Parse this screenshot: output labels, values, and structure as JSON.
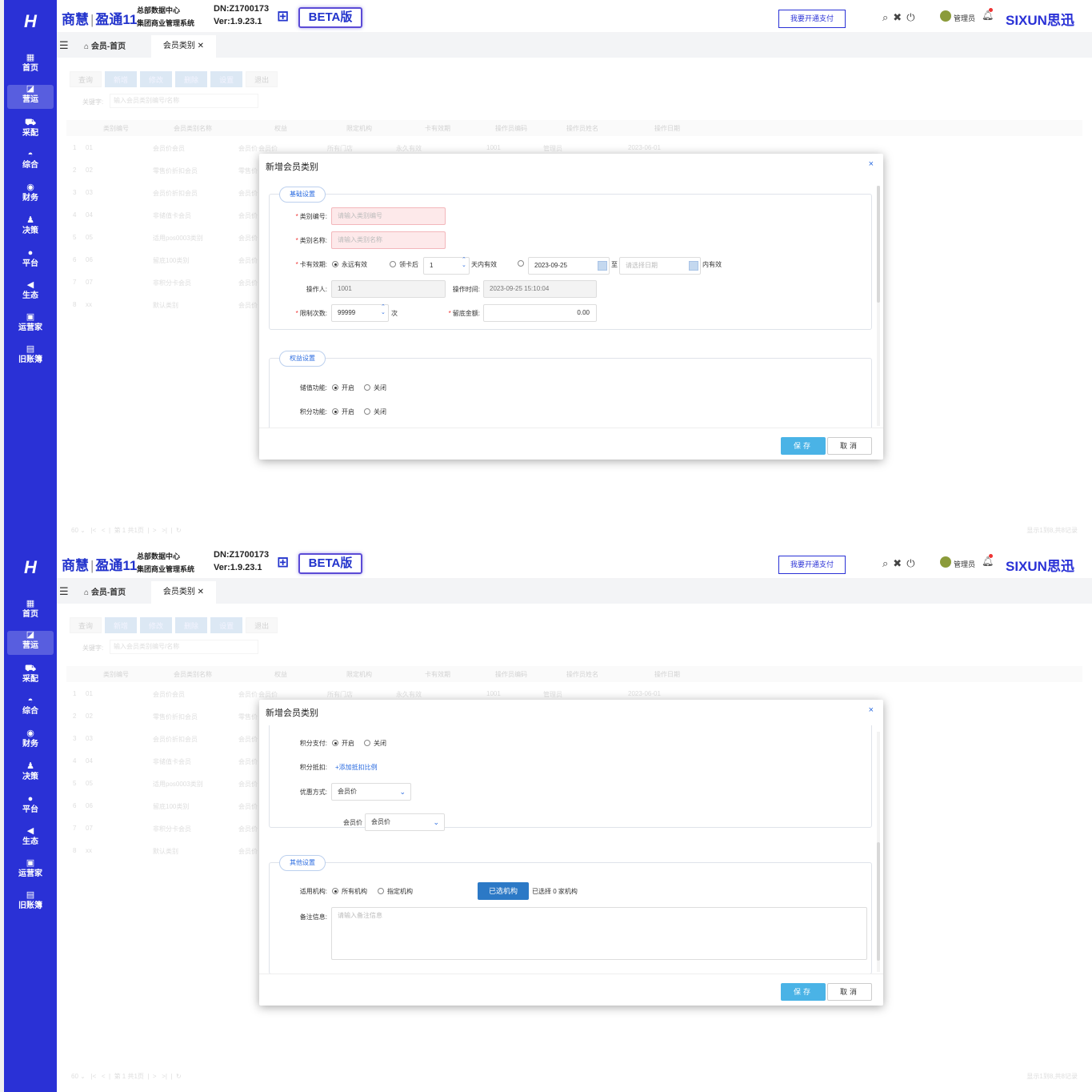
{
  "app": {
    "logo": "H",
    "brand_left": "商慧",
    "brand_right": "盈通11",
    "sys_line1": "总部数据中心",
    "sys_line2": "集团商业管理系统",
    "dn": "DN:Z1700173",
    "ver": "Ver:1.9.23.1",
    "beta": "BETA版",
    "pay_button": "我要开通支付",
    "user": "管理员",
    "vendor": "SIXUN思迅"
  },
  "sidebar": {
    "items": [
      {
        "label": "首页",
        "icon": "home-icon",
        "glyph": "▦"
      },
      {
        "label": "营运",
        "icon": "chart-icon",
        "glyph": "◪"
      },
      {
        "label": "采配",
        "icon": "truck-icon",
        "glyph": "⛟"
      },
      {
        "label": "综合",
        "icon": "bag-icon",
        "glyph": "◓"
      },
      {
        "label": "财务",
        "icon": "finance-icon",
        "glyph": "◉"
      },
      {
        "label": "决策",
        "icon": "decision-icon",
        "glyph": "♟"
      },
      {
        "label": "平台",
        "icon": "platform-icon",
        "glyph": "●"
      },
      {
        "label": "生态",
        "icon": "ecology-icon",
        "glyph": "◀"
      },
      {
        "label": "运营家",
        "icon": "operator-icon",
        "glyph": "▣"
      },
      {
        "label": "旧账簿",
        "icon": "ledger-icon",
        "glyph": "▤"
      }
    ]
  },
  "tabs": {
    "home": "会员-首页",
    "active": "会员类别"
  },
  "toolbar": {
    "query": "查询",
    "add": "新增",
    "edit": "修改",
    "delete": "删除",
    "settings": "设置",
    "exit": "退出"
  },
  "search": {
    "label": "关键字:",
    "placeholder": "输入会员类别编号/名称"
  },
  "table": {
    "headers": [
      "类别编号",
      "会员类别名称",
      "权益",
      "限定机构",
      "卡有效期",
      "操作员编码",
      "操作员姓名",
      "操作日期"
    ],
    "rows": [
      {
        "idx": "1",
        "code": "01",
        "name": "会员价会员",
        "benefit": "会员价"
      },
      {
        "idx": "2",
        "code": "02",
        "name": "零售价折扣会员",
        "benefit": "零售价"
      },
      {
        "idx": "3",
        "code": "03",
        "name": "会员价折扣会员",
        "benefit": "会员价"
      },
      {
        "idx": "4",
        "code": "04",
        "name": "非储值卡会员",
        "benefit": "会员价"
      },
      {
        "idx": "5",
        "code": "05",
        "name": "适用pos0003类别",
        "benefit": "会员价"
      },
      {
        "idx": "6",
        "code": "06",
        "name": "留底100类别",
        "benefit": "会员价"
      },
      {
        "idx": "7",
        "code": "07",
        "name": "非积分卡会员",
        "benefit": "会员价"
      },
      {
        "idx": "8",
        "code": "xx",
        "name": "默认类别",
        "benefit": "会员价"
      }
    ],
    "first_row_extra": {
      "benefit2": "会员价",
      "org": "所有门店",
      "validity": "永久有效",
      "op_code": "1001",
      "op_name": "管理员",
      "date": "2023-06-01"
    }
  },
  "pager": {
    "page_size": "60",
    "page_label": "第",
    "page": "1",
    "total_pages": "共1页",
    "summary": "显示1到8,共8记录"
  },
  "dialog": {
    "title": "新增会员类别",
    "close": "×",
    "section_basic": "基础设置",
    "code_label": "类别编号:",
    "code_placeholder": "请输入类别编号",
    "name_label": "类别名称:",
    "name_placeholder": "请输入类别名称",
    "validity_label": "卡有效期:",
    "forever": "永远有效",
    "after_receive": "领卡后",
    "days_value": "1",
    "days_suffix": "天内有效",
    "start_date": "2023-09-25",
    "to": "至",
    "end_placeholder": "请选择日期",
    "within": "内有效",
    "operator_label": "操作人:",
    "operator_value": "1001",
    "optime_label": "操作时间:",
    "optime_value": "2023-09-25 15:10:04",
    "limit_label": "限制次数:",
    "limit_value": "99999",
    "limit_unit": "次",
    "reserve_label": "留底金额:",
    "reserve_value": "0.00",
    "section_rights": "权益设置",
    "stored_label": "储值功能:",
    "points_label": "积分功能:",
    "on": "开启",
    "off": "关闭",
    "points_pay_label": "积分支付:",
    "points_deduct_label": "积分抵扣:",
    "points_deduct_link": "+添加抵扣比例",
    "discount_label": "优惠方式:",
    "discount_value": "会员价",
    "member_price_label": "会员价",
    "member_price_value": "会员价",
    "section_other": "其他设置",
    "org_label": "适用机构:",
    "all_orgs": "所有机构",
    "specific_orgs": "指定机构",
    "selected_btn": "已选机构",
    "selected_text": "已选择 0 家机构",
    "remark_label": "备注信息:",
    "remark_placeholder": "请输入备注信息",
    "save": "保存",
    "cancel": "取消"
  }
}
